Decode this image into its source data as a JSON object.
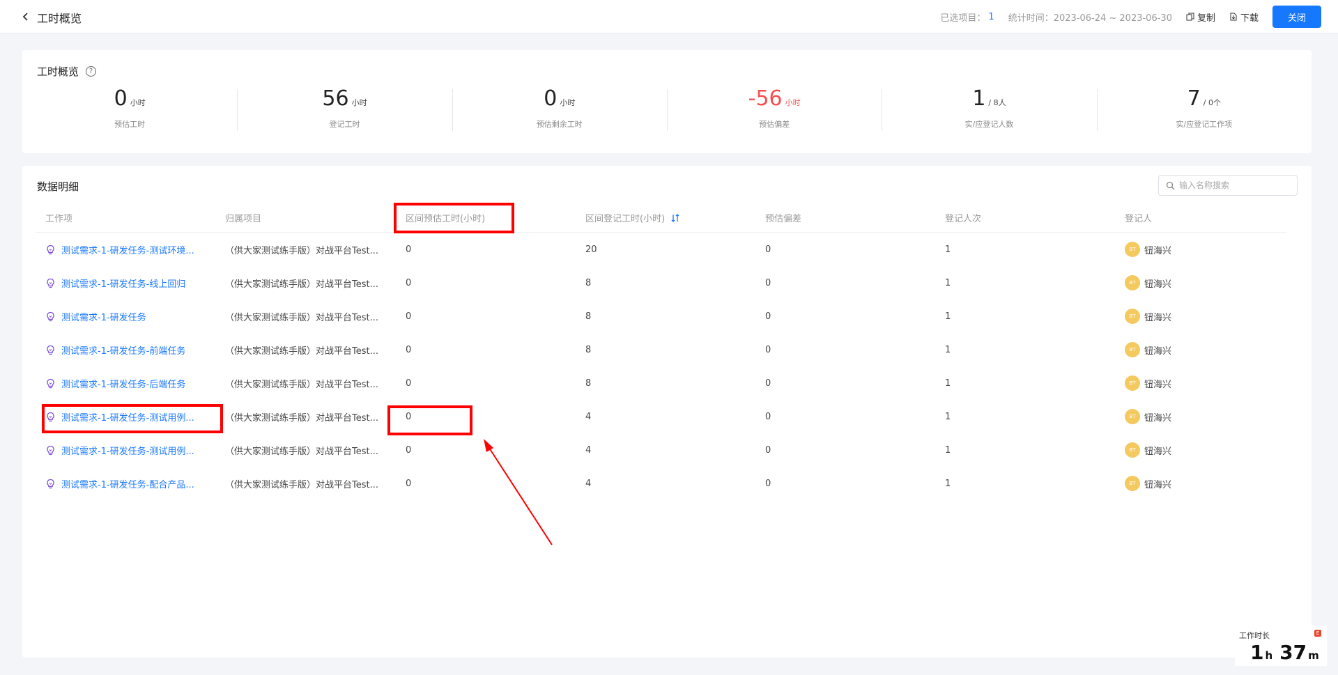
{
  "header": {
    "title": "工时概览",
    "selected_label": "已选项目：",
    "selected_count": "1",
    "stat_time": "统计时间：2023-06-24 ~ 2023-06-30",
    "copy_label": "复制",
    "download_label": "下载",
    "close_label": "关闭"
  },
  "overview": {
    "title": "工时概览",
    "help_glyph": "?",
    "stats": [
      {
        "value": "0",
        "unit": "小时",
        "label": "预估工时"
      },
      {
        "value": "56",
        "unit": "小时",
        "label": "登记工时"
      },
      {
        "value": "0",
        "unit": "小时",
        "label": "预估剩余工时"
      },
      {
        "value": "-56",
        "unit": "小时",
        "label": "预估偏差"
      },
      {
        "value": "1",
        "unit": "/ 8人",
        "label": "实/应登记人数"
      },
      {
        "value": "7",
        "unit": "/ 0个",
        "label": "实/应登记工作项"
      }
    ]
  },
  "detail": {
    "title": "数据明细",
    "search_placeholder": "输入名称搜索",
    "columns": [
      "工作项",
      "归属项目",
      "区间预估工时(小时)",
      "区间登记工时(小时)",
      "预估偏差",
      "登记人次",
      "登记人"
    ],
    "rows": [
      {
        "name": "测试需求-1-研发任务-测试环境...",
        "project": "（供大家测试练手版）对战平台Test...",
        "est": "0",
        "reg": "20",
        "dev": "0",
        "count": "1",
        "avatar": "BT",
        "person": "钮海兴"
      },
      {
        "name": "测试需求-1-研发任务-线上回归",
        "project": "（供大家测试练手版）对战平台Test...",
        "est": "0",
        "reg": "8",
        "dev": "0",
        "count": "1",
        "avatar": "BT",
        "person": "钮海兴"
      },
      {
        "name": "测试需求-1-研发任务",
        "project": "（供大家测试练手版）对战平台Test...",
        "est": "0",
        "reg": "8",
        "dev": "0",
        "count": "1",
        "avatar": "BT",
        "person": "钮海兴"
      },
      {
        "name": "测试需求-1-研发任务-前端任务",
        "project": "（供大家测试练手版）对战平台Test...",
        "est": "0",
        "reg": "8",
        "dev": "0",
        "count": "1",
        "avatar": "BT",
        "person": "钮海兴"
      },
      {
        "name": "测试需求-1-研发任务-后端任务",
        "project": "（供大家测试练手版）对战平台Test...",
        "est": "0",
        "reg": "8",
        "dev": "0",
        "count": "1",
        "avatar": "BT",
        "person": "钮海兴"
      },
      {
        "name": "测试需求-1-研发任务-测试用例...",
        "project": "（供大家测试练手版）对战平台Test...",
        "est": "0",
        "reg": "4",
        "dev": "0",
        "count": "1",
        "avatar": "BT",
        "person": "钮海兴"
      },
      {
        "name": "测试需求-1-研发任务-测试用例...",
        "project": "（供大家测试练手版）对战平台Test...",
        "est": "0",
        "reg": "4",
        "dev": "0",
        "count": "1",
        "avatar": "BT",
        "person": "钮海兴"
      },
      {
        "name": "测试需求-1-研发任务-配合产品...",
        "project": "（供大家测试练手版）对战平台Test...",
        "est": "0",
        "reg": "4",
        "dev": "0",
        "count": "1",
        "avatar": "BT",
        "person": "钮海兴"
      }
    ]
  },
  "timer": {
    "label": "工作时长",
    "badge": "E",
    "hours": "1",
    "hours_unit": "h",
    "minutes": "37",
    "minutes_unit": "m"
  },
  "colors": {
    "accent": "#1677ff",
    "negative": "#f5504f",
    "annotation": "#ff0000",
    "avatar": "#f4c95d"
  }
}
